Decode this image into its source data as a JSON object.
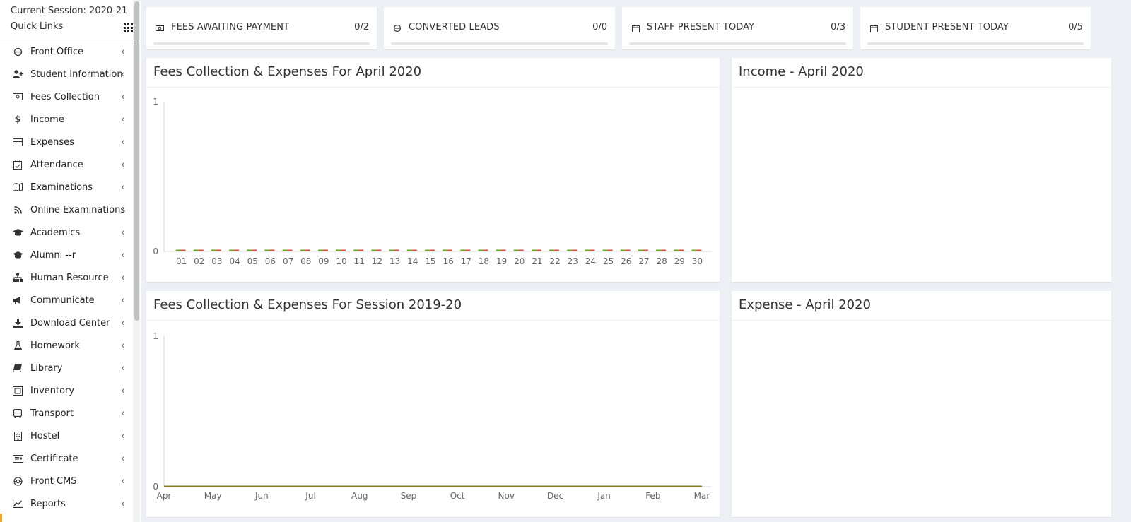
{
  "sidebar": {
    "session_label": "Current Session: 2020-21",
    "quick_links_label": "Quick Links",
    "quick_links_icon": "grid-icon",
    "items": [
      {
        "label": "Front Office",
        "icon": "front-office-icon"
      },
      {
        "label": "Student Information",
        "icon": "user-plus-icon"
      },
      {
        "label": "Fees Collection",
        "icon": "money-icon"
      },
      {
        "label": "Income",
        "icon": "dollar-icon"
      },
      {
        "label": "Expenses",
        "icon": "credit-card-icon"
      },
      {
        "label": "Attendance",
        "icon": "calendar-check-icon"
      },
      {
        "label": "Examinations",
        "icon": "map-icon"
      },
      {
        "label": "Online Examinations",
        "icon": "rss-icon"
      },
      {
        "label": "Academics",
        "icon": "graduation-cap-icon"
      },
      {
        "label": "Alumni --r",
        "icon": "graduation-cap-icon"
      },
      {
        "label": "Human Resource",
        "icon": "sitemap-icon"
      },
      {
        "label": "Communicate",
        "icon": "bullhorn-icon"
      },
      {
        "label": "Download Center",
        "icon": "download-icon"
      },
      {
        "label": "Homework",
        "icon": "flask-icon"
      },
      {
        "label": "Library",
        "icon": "book-icon"
      },
      {
        "label": "Inventory",
        "icon": "inventory-icon"
      },
      {
        "label": "Transport",
        "icon": "bus-icon"
      },
      {
        "label": "Hostel",
        "icon": "building-icon"
      },
      {
        "label": "Certificate",
        "icon": "certificate-icon"
      },
      {
        "label": "Front CMS",
        "icon": "cms-icon"
      },
      {
        "label": "Reports",
        "icon": "line-chart-icon"
      }
    ],
    "chevron": "‹"
  },
  "stats": [
    {
      "label": "FEES AWAITING PAYMENT",
      "value": "0/2",
      "icon": "money-icon",
      "progress": 0
    },
    {
      "label": "CONVERTED LEADS",
      "value": "0/0",
      "icon": "front-office-icon",
      "progress": 0
    },
    {
      "label": "STAFF PRESENT TODAY",
      "value": "0/3",
      "icon": "calendar-icon",
      "progress": 0
    },
    {
      "label": "STUDENT PRESENT TODAY",
      "value": "0/5",
      "icon": "calendar-icon",
      "progress": 0
    }
  ],
  "panels": {
    "monthly_title": "Fees Collection & Expenses For April 2020",
    "income_title": "Income - April 2020",
    "session_title": "Fees Collection & Expenses For Session 2019-20",
    "expense_title": "Expense - April 2020"
  },
  "colors": {
    "fees": "#66aa18",
    "expense": "#dd4b39",
    "session_line": "#8b7d1c",
    "accent": "#f5a623"
  },
  "chart_data": [
    {
      "type": "bar",
      "categories": [
        "01",
        "02",
        "03",
        "04",
        "05",
        "06",
        "07",
        "08",
        "09",
        "10",
        "11",
        "12",
        "13",
        "14",
        "15",
        "16",
        "17",
        "18",
        "19",
        "20",
        "21",
        "22",
        "23",
        "24",
        "25",
        "26",
        "27",
        "28",
        "29",
        "30"
      ],
      "series": [
        {
          "values": [
            0,
            0,
            0,
            0,
            0,
            0,
            0,
            0,
            0,
            0,
            0,
            0,
            0,
            0,
            0,
            0,
            0,
            0,
            0,
            0,
            0,
            0,
            0,
            0,
            0,
            0,
            0,
            0,
            0,
            0
          ]
        },
        {
          "values": [
            0,
            0,
            0,
            0,
            0,
            0,
            0,
            0,
            0,
            0,
            0,
            0,
            0,
            0,
            0,
            0,
            0,
            0,
            0,
            0,
            0,
            0,
            0,
            0,
            0,
            0,
            0,
            0,
            0,
            0
          ]
        }
      ],
      "ylim": [
        0,
        1
      ],
      "yticks": [
        "0",
        "1"
      ]
    },
    {
      "type": "line",
      "categories": [
        "Apr",
        "May",
        "Jun",
        "Jul",
        "Aug",
        "Sep",
        "Oct",
        "Nov",
        "Dec",
        "Jan",
        "Feb",
        "Mar"
      ],
      "series": [
        {
          "values": [
            0,
            0,
            0,
            0,
            0,
            0,
            0,
            0,
            0,
            0,
            0,
            0
          ]
        },
        {
          "values": [
            0,
            0,
            0,
            0,
            0,
            0,
            0,
            0,
            0,
            0,
            0,
            0
          ]
        }
      ],
      "ylim": [
        0,
        1
      ],
      "yticks": [
        "0",
        "1"
      ]
    }
  ]
}
